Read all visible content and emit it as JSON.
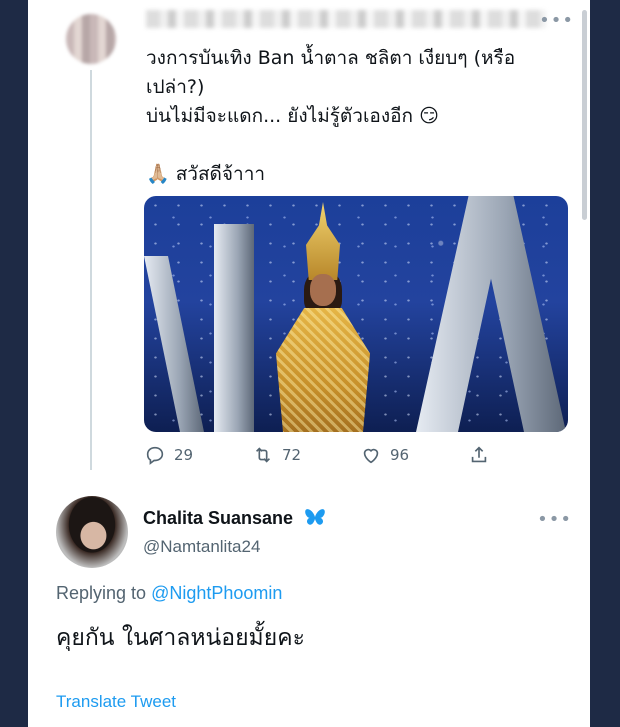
{
  "tweet1": {
    "author_name": "",
    "text": "วงการบันเทิง Ban น้ำตาล ชลิตา เงียบๆ (หรือ\nเปล่า?)\nบ่นไม่มีจะแดก... ยังไม่รู้ตัวเองอีก 😏\n\n🙏🏼 สวัสดีจ้าาา",
    "more": "•••",
    "replies": "29",
    "retweets": "72",
    "likes": "96"
  },
  "tweet2": {
    "name": "Chalita Suansane",
    "handle": "@Namtanlita24",
    "more": "•••",
    "replying_prefix": "Replying to",
    "replying_to": "@NightPhoomin",
    "text": "คุยกัน ในศาลหน่อยมั้ยคะ",
    "translate": "Translate Tweet"
  },
  "colors": {
    "link": "#1d9bf0",
    "secondary_text": "#536471",
    "verified_butterfly": "#1d9bf0"
  }
}
